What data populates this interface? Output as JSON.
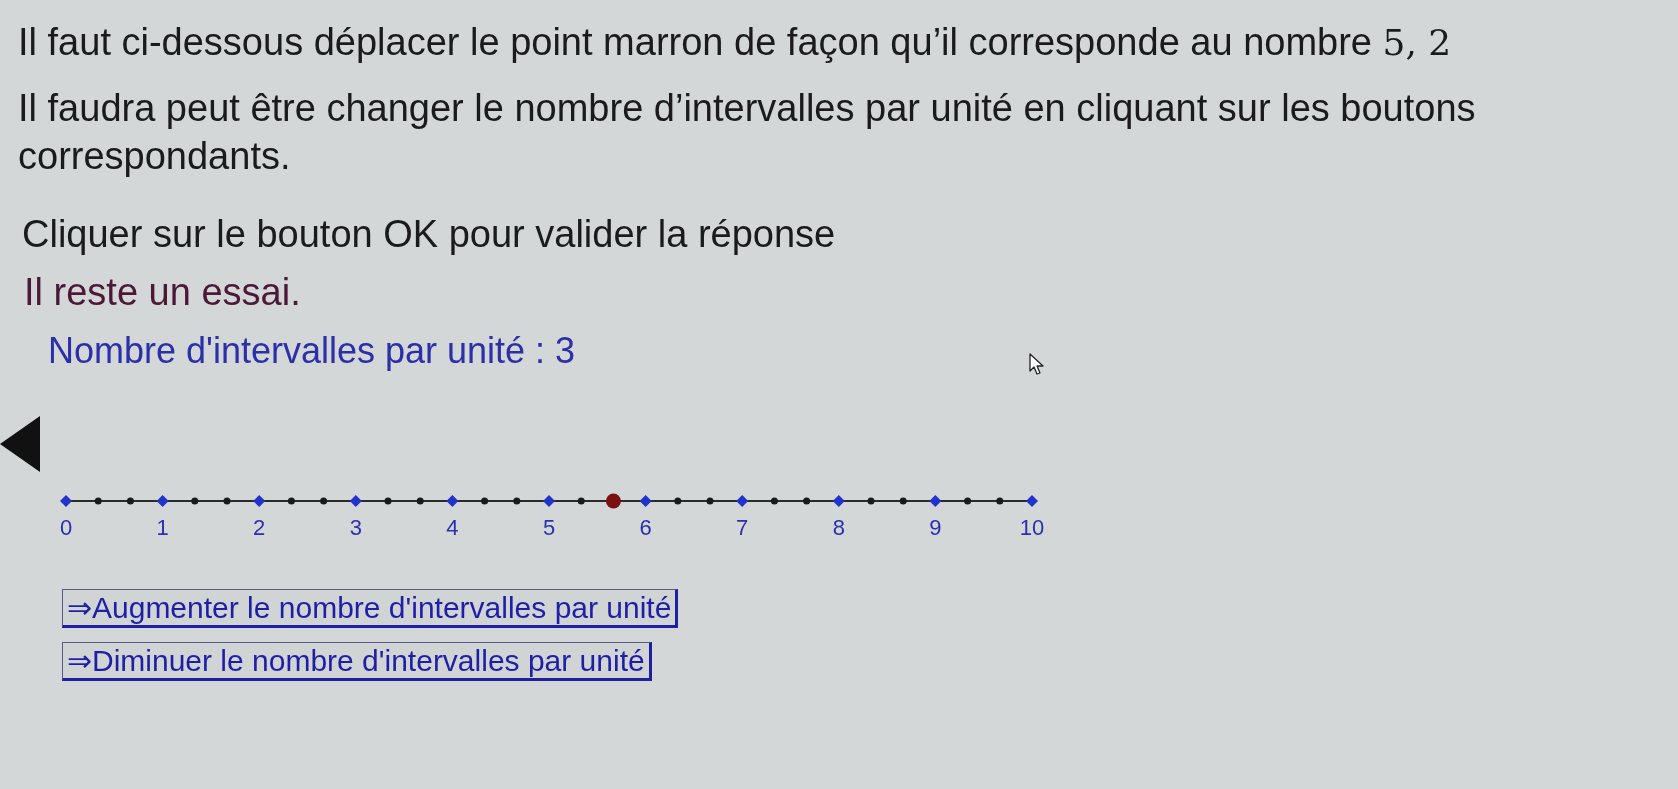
{
  "instruction": {
    "text": "Il faut ci-dessous déplacer le point marron de façon qu’il corresponde au nombre ",
    "math": "5, 2"
  },
  "hint": "Il faudra peut être changer le nombre d’intervalles par unité en cliquant sur les boutons correspondants.",
  "validate_note": "Cliquer sur le bouton OK pour valider la réponse",
  "attempts_message": "Il reste un essai.",
  "intervals_label": "Nombre d'intervalles par unité : 3",
  "number_line": {
    "ticks": [
      {
        "kind": "major",
        "label": "0"
      },
      {
        "kind": "minor"
      },
      {
        "kind": "minor"
      },
      {
        "kind": "major",
        "label": "1"
      },
      {
        "kind": "minor"
      },
      {
        "kind": "minor"
      },
      {
        "kind": "major",
        "label": "2"
      },
      {
        "kind": "minor"
      },
      {
        "kind": "minor"
      },
      {
        "kind": "major",
        "label": "3"
      },
      {
        "kind": "minor"
      },
      {
        "kind": "minor"
      },
      {
        "kind": "major",
        "label": "4"
      },
      {
        "kind": "minor"
      },
      {
        "kind": "minor"
      },
      {
        "kind": "major",
        "label": "5"
      },
      {
        "kind": "minor"
      },
      {
        "kind": "minor"
      },
      {
        "kind": "major",
        "label": "6"
      },
      {
        "kind": "minor"
      },
      {
        "kind": "minor"
      },
      {
        "kind": "major",
        "label": "7"
      },
      {
        "kind": "minor"
      },
      {
        "kind": "minor"
      },
      {
        "kind": "major",
        "label": "8"
      },
      {
        "kind": "minor"
      },
      {
        "kind": "minor"
      },
      {
        "kind": "major",
        "label": "9"
      },
      {
        "kind": "minor"
      },
      {
        "kind": "minor"
      },
      {
        "kind": "major",
        "label": "10"
      }
    ],
    "point": {
      "level": 0.5667
    }
  },
  "buttons": [
    "⇒Augmenter le nombre d'intervalles par unité",
    "⇒Diminuer le nombre d'intervalles par unité"
  ]
}
